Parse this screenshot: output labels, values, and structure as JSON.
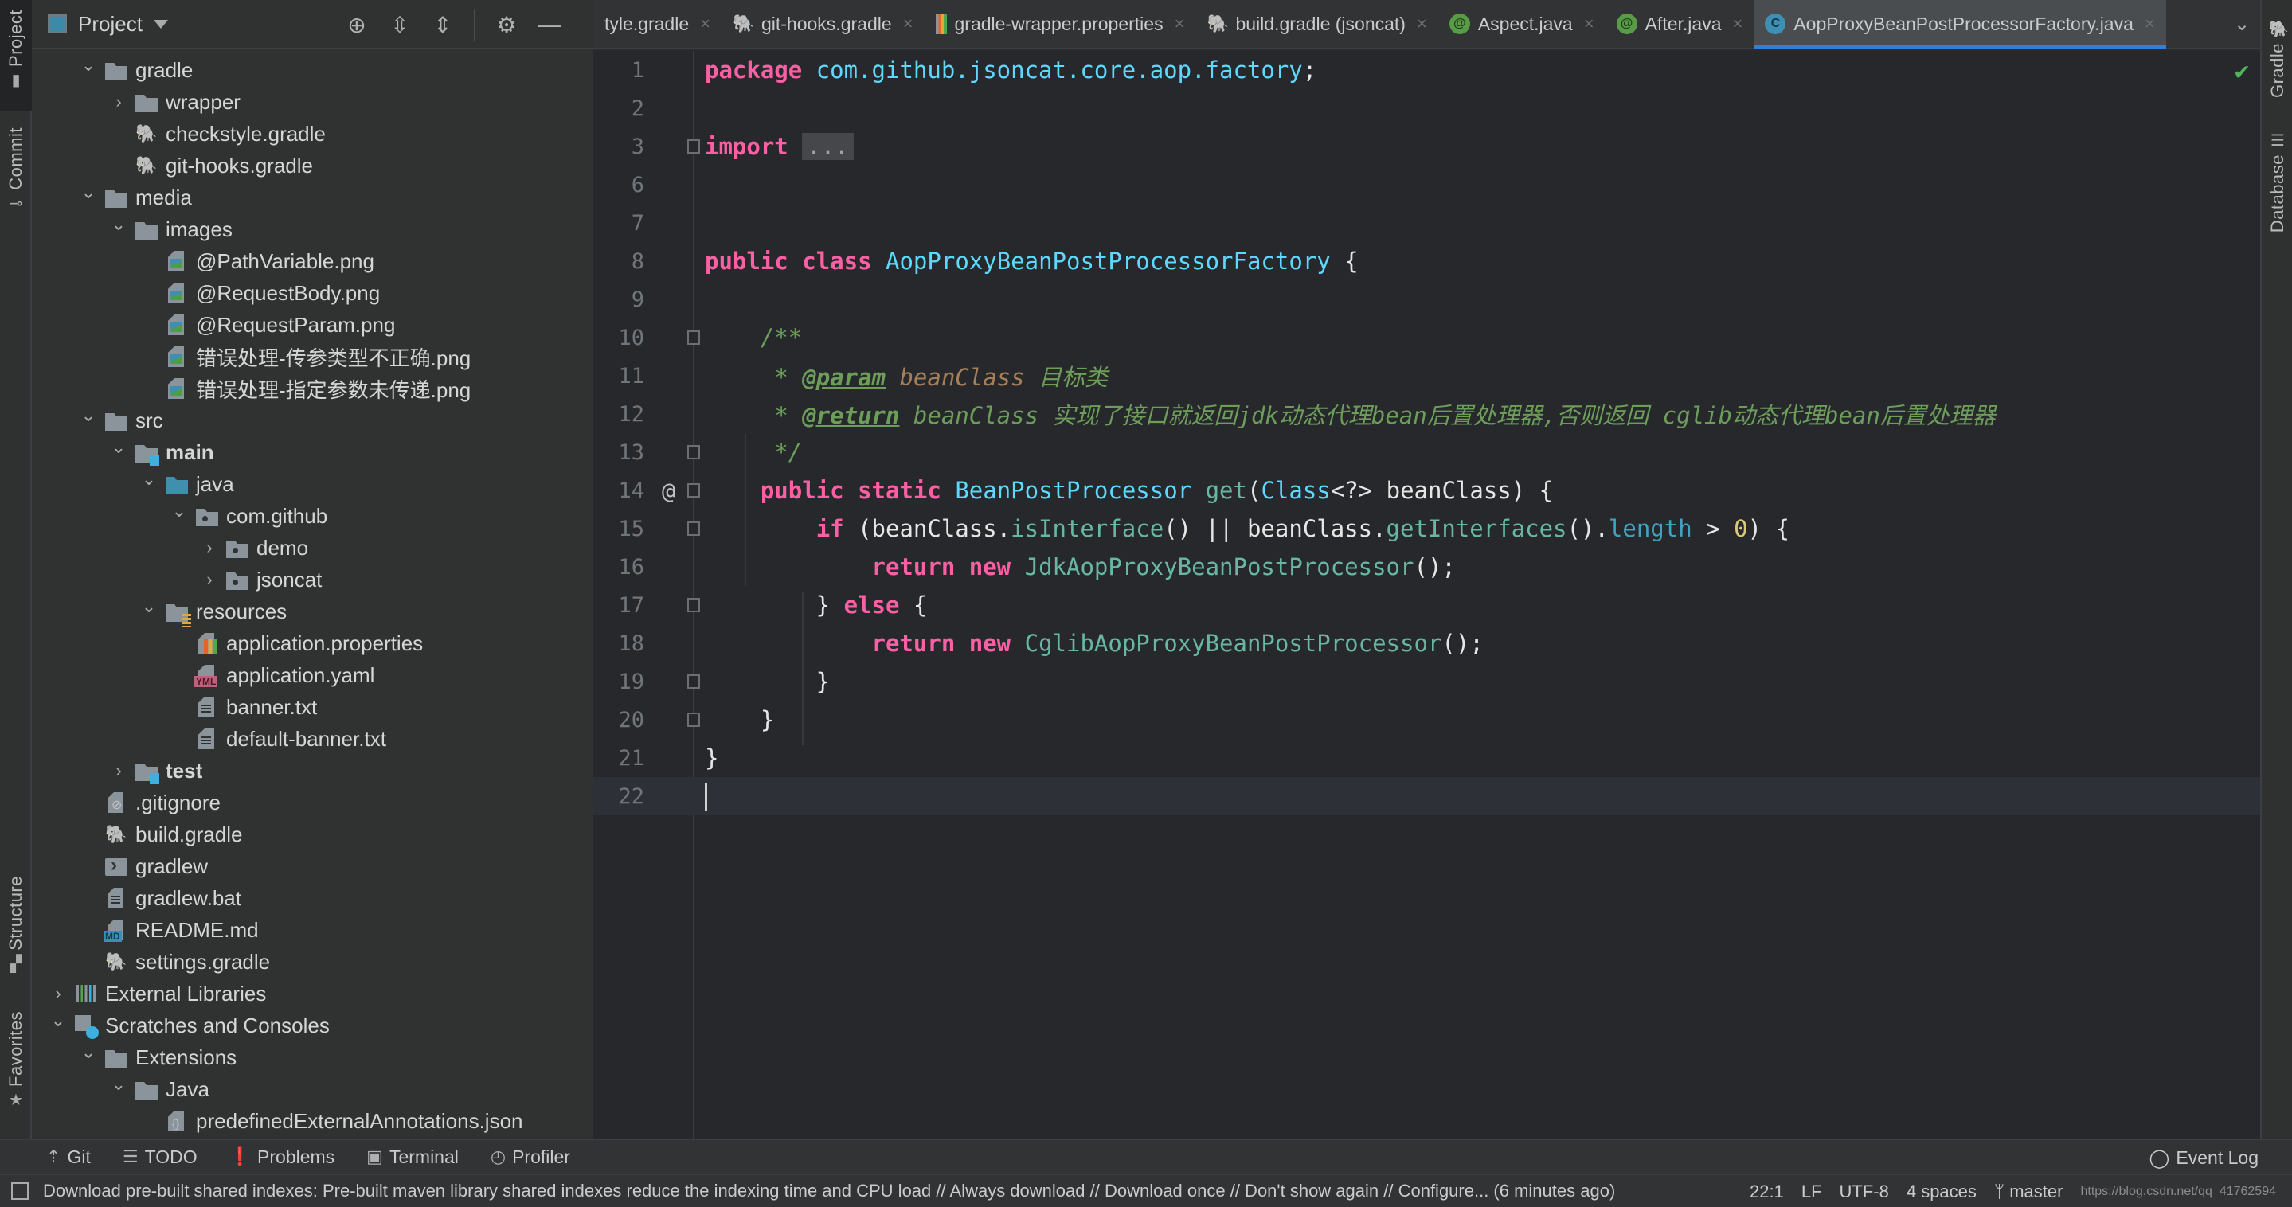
{
  "left_strip": {
    "tabs": [
      {
        "label": "Project",
        "icon": "folder-icon",
        "active": true
      },
      {
        "label": "Commit",
        "icon": "commit-icon",
        "active": false
      },
      {
        "label": "Structure",
        "icon": "structure-icon",
        "active": false
      },
      {
        "label": "Favorites",
        "icon": "star-icon",
        "active": false
      }
    ]
  },
  "right_strip": {
    "tabs": [
      {
        "label": "Gradle",
        "icon": "gradle-icon"
      },
      {
        "label": "Database",
        "icon": "database-icon"
      }
    ]
  },
  "project_panel": {
    "title": "Project",
    "tools": [
      "locate-icon",
      "expand-all-icon",
      "collapse-all-icon",
      "gear-icon",
      "minimize-icon"
    ],
    "tree": [
      {
        "label": "gradle",
        "depth": 1,
        "arrow": "down",
        "icon": "folder"
      },
      {
        "label": "wrapper",
        "depth": 2,
        "arrow": "right",
        "icon": "folder"
      },
      {
        "label": "checkstyle.gradle",
        "depth": 2,
        "arrow": "none",
        "icon": "gradle"
      },
      {
        "label": "git-hooks.gradle",
        "depth": 2,
        "arrow": "none",
        "icon": "gradle"
      },
      {
        "label": "media",
        "depth": 1,
        "arrow": "down",
        "icon": "folder"
      },
      {
        "label": "images",
        "depth": 2,
        "arrow": "down",
        "icon": "folder"
      },
      {
        "label": "@PathVariable.png",
        "depth": 3,
        "arrow": "none",
        "icon": "image"
      },
      {
        "label": "@RequestBody.png",
        "depth": 3,
        "arrow": "none",
        "icon": "image"
      },
      {
        "label": "@RequestParam.png",
        "depth": 3,
        "arrow": "none",
        "icon": "image"
      },
      {
        "label": "错误处理-传参类型不正确.png",
        "depth": 3,
        "arrow": "none",
        "icon": "image"
      },
      {
        "label": "错误处理-指定参数未传递.png",
        "depth": 3,
        "arrow": "none",
        "icon": "image"
      },
      {
        "label": "src",
        "depth": 1,
        "arrow": "down",
        "icon": "folder"
      },
      {
        "label": "main",
        "depth": 2,
        "arrow": "down",
        "icon": "source-root",
        "bold": true
      },
      {
        "label": "java",
        "depth": 3,
        "arrow": "down",
        "icon": "folder-blue"
      },
      {
        "label": "com.github",
        "depth": 4,
        "arrow": "down",
        "icon": "package"
      },
      {
        "label": "demo",
        "depth": 5,
        "arrow": "right",
        "icon": "package"
      },
      {
        "label": "jsoncat",
        "depth": 5,
        "arrow": "right",
        "icon": "package"
      },
      {
        "label": "resources",
        "depth": 3,
        "arrow": "down",
        "icon": "resources"
      },
      {
        "label": "application.properties",
        "depth": 4,
        "arrow": "none",
        "icon": "properties"
      },
      {
        "label": "application.yaml",
        "depth": 4,
        "arrow": "none",
        "icon": "yaml"
      },
      {
        "label": "banner.txt",
        "depth": 4,
        "arrow": "none",
        "icon": "text"
      },
      {
        "label": "default-banner.txt",
        "depth": 4,
        "arrow": "none",
        "icon": "text"
      },
      {
        "label": "test",
        "depth": 2,
        "arrow": "right",
        "icon": "source-root",
        "bold": true
      },
      {
        "label": ".gitignore",
        "depth": 1,
        "arrow": "none",
        "icon": "gitignore"
      },
      {
        "label": "build.gradle",
        "depth": 1,
        "arrow": "none",
        "icon": "gradle"
      },
      {
        "label": "gradlew",
        "depth": 1,
        "arrow": "none",
        "icon": "shell"
      },
      {
        "label": "gradlew.bat",
        "depth": 1,
        "arrow": "none",
        "icon": "text"
      },
      {
        "label": "README.md",
        "depth": 1,
        "arrow": "none",
        "icon": "markdown"
      },
      {
        "label": "settings.gradle",
        "depth": 1,
        "arrow": "none",
        "icon": "gradle"
      },
      {
        "label": "External Libraries",
        "depth": 0,
        "arrow": "right",
        "icon": "libraries"
      },
      {
        "label": "Scratches and Consoles",
        "depth": 0,
        "arrow": "down",
        "icon": "scratches"
      },
      {
        "label": "Extensions",
        "depth": 1,
        "arrow": "down",
        "icon": "folder"
      },
      {
        "label": "Java",
        "depth": 2,
        "arrow": "down",
        "icon": "folder"
      },
      {
        "label": "predefinedExternalAnnotations.json",
        "depth": 3,
        "arrow": "none",
        "icon": "json"
      }
    ]
  },
  "tabs": [
    {
      "label": "tyle.gradle",
      "icon": "none",
      "active": false
    },
    {
      "label": "git-hooks.gradle",
      "icon": "gradle",
      "active": false
    },
    {
      "label": "gradle-wrapper.properties",
      "icon": "properties",
      "active": false
    },
    {
      "label": "build.gradle (jsoncat)",
      "icon": "gradle",
      "active": false
    },
    {
      "label": "Aspect.java",
      "icon": "annotation",
      "active": false
    },
    {
      "label": "After.java",
      "icon": "annotation",
      "active": false
    },
    {
      "label": "AopProxyBeanPostProcessorFactory.java",
      "icon": "class",
      "active": true
    }
  ],
  "tab_icon_glyphs": {
    "annotation": "@",
    "class": "C"
  },
  "editor": {
    "lines": [
      {
        "n": "1",
        "tokens": [
          [
            "kw",
            "package"
          ],
          [
            "",
            " "
          ],
          [
            "pkg",
            "com.github.jsoncat.core.aop.factory"
          ],
          [
            "",
            ";"
          ]
        ]
      },
      {
        "n": "2",
        "tokens": []
      },
      {
        "n": "3",
        "fold": "plus",
        "tokens": [
          [
            "kw",
            "import"
          ],
          [
            "",
            " "
          ],
          [
            "folded",
            "..."
          ]
        ]
      },
      {
        "n": "6",
        "tokens": []
      },
      {
        "n": "7",
        "tokens": []
      },
      {
        "n": "8",
        "tokens": [
          [
            "kw",
            "public"
          ],
          [
            "",
            " "
          ],
          [
            "kw",
            "class"
          ],
          [
            "",
            " "
          ],
          [
            "cls",
            "AopProxyBeanPostProcessorFactory"
          ],
          [
            "",
            " {"
          ]
        ]
      },
      {
        "n": "9",
        "tokens": []
      },
      {
        "n": "10",
        "fold": "start",
        "tokens": [
          [
            "",
            "    "
          ],
          [
            "cm",
            "/**"
          ]
        ]
      },
      {
        "n": "11",
        "tokens": [
          [
            "",
            "     "
          ],
          [
            "cm",
            "* "
          ],
          [
            "cm-tag",
            "@param"
          ],
          [
            "cm",
            " "
          ],
          [
            "cm-param",
            "beanClass"
          ],
          [
            "cm",
            " 目标类"
          ]
        ]
      },
      {
        "n": "12",
        "tokens": [
          [
            "",
            "     "
          ],
          [
            "cm",
            "* "
          ],
          [
            "cm-tag",
            "@return"
          ],
          [
            "cm",
            " beanClass 实现了接口就返回jdk动态代理bean后置处理器,否则返回 cglib动态代理bean后置处理器"
          ]
        ]
      },
      {
        "n": "13",
        "fold": "end",
        "tokens": [
          [
            "",
            "     "
          ],
          [
            "cm",
            "*/"
          ]
        ]
      },
      {
        "n": "14",
        "gutter_mark": "@",
        "fold": "start",
        "tokens": [
          [
            "",
            "    "
          ],
          [
            "kw",
            "public"
          ],
          [
            "",
            " "
          ],
          [
            "kw",
            "static"
          ],
          [
            "",
            " "
          ],
          [
            "cls",
            "BeanPostProcessor"
          ],
          [
            "",
            " "
          ],
          [
            "fn",
            "get"
          ],
          [
            "",
            "("
          ],
          [
            "cls",
            "Class"
          ],
          [
            "",
            "<?> beanClass) {"
          ]
        ]
      },
      {
        "n": "15",
        "fold": "start",
        "tokens": [
          [
            "",
            "        "
          ],
          [
            "kw",
            "if"
          ],
          [
            "",
            " (beanClass."
          ],
          [
            "fn",
            "isInterface"
          ],
          [
            "",
            "() || beanClass."
          ],
          [
            "fn",
            "getInterfaces"
          ],
          [
            "",
            "()."
          ],
          [
            "field",
            "length"
          ],
          [
            "",
            " > "
          ],
          [
            "num",
            "0"
          ],
          [
            "",
            ") {"
          ]
        ]
      },
      {
        "n": "16",
        "tokens": [
          [
            "",
            "            "
          ],
          [
            "kw",
            "return"
          ],
          [
            "",
            " "
          ],
          [
            "kw",
            "new"
          ],
          [
            "",
            " "
          ],
          [
            "fn",
            "JdkAopProxyBeanPostProcessor"
          ],
          [
            "",
            "();"
          ]
        ]
      },
      {
        "n": "17",
        "fold": "end",
        "tokens": [
          [
            "",
            "        } "
          ],
          [
            "kw",
            "else"
          ],
          [
            "",
            " {"
          ]
        ]
      },
      {
        "n": "18",
        "tokens": [
          [
            "",
            "            "
          ],
          [
            "kw",
            "return"
          ],
          [
            "",
            " "
          ],
          [
            "kw",
            "new"
          ],
          [
            "",
            " "
          ],
          [
            "fn",
            "CglibAopProxyBeanPostProcessor"
          ],
          [
            "",
            "();"
          ]
        ]
      },
      {
        "n": "19",
        "fold": "end",
        "tokens": [
          [
            "",
            "        }"
          ]
        ]
      },
      {
        "n": "20",
        "fold": "end",
        "tokens": [
          [
            "",
            "    }"
          ]
        ]
      },
      {
        "n": "21",
        "tokens": [
          [
            "",
            "}"
          ]
        ]
      },
      {
        "n": "22",
        "current": true,
        "caret": true,
        "tokens": []
      }
    ],
    "inspection_status": "check-icon"
  },
  "bottom_tools": [
    {
      "label": "Git",
      "icon": "git-icon",
      "glyph": "⇡"
    },
    {
      "label": "TODO",
      "icon": "todo-icon",
      "glyph": "☰"
    },
    {
      "label": "Problems",
      "icon": "problems-icon",
      "glyph": "❗"
    },
    {
      "label": "Terminal",
      "icon": "terminal-icon",
      "glyph": "▣"
    },
    {
      "label": "Profiler",
      "icon": "profiler-icon",
      "glyph": "◴"
    }
  ],
  "event_log": {
    "label": "Event Log"
  },
  "status": {
    "message": "Download pre-built shared indexes: Pre-built maven library shared indexes reduce the indexing time and CPU load // Always download // Download once // Don't show again // Configure... (6 minutes ago)",
    "position": "22:1",
    "line_sep": "LF",
    "encoding": "UTF-8",
    "indent": "4 spaces",
    "branch": "master",
    "watermark": "https://blog.csdn.net/qq_41762594"
  }
}
